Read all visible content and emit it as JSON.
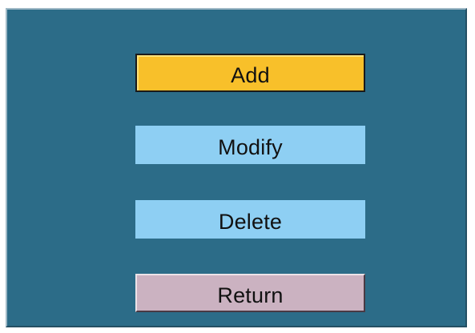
{
  "menu": {
    "items": [
      {
        "label": "Add",
        "state": "selected",
        "color": "#f8c02a"
      },
      {
        "label": "Modify",
        "state": "normal",
        "color": "#8ecff3"
      },
      {
        "label": "Delete",
        "state": "normal",
        "color": "#8ecff3"
      },
      {
        "label": "Return",
        "state": "normal",
        "color": "#cbb2c1"
      }
    ]
  },
  "theme": {
    "panel_color": "#2c6c88"
  }
}
